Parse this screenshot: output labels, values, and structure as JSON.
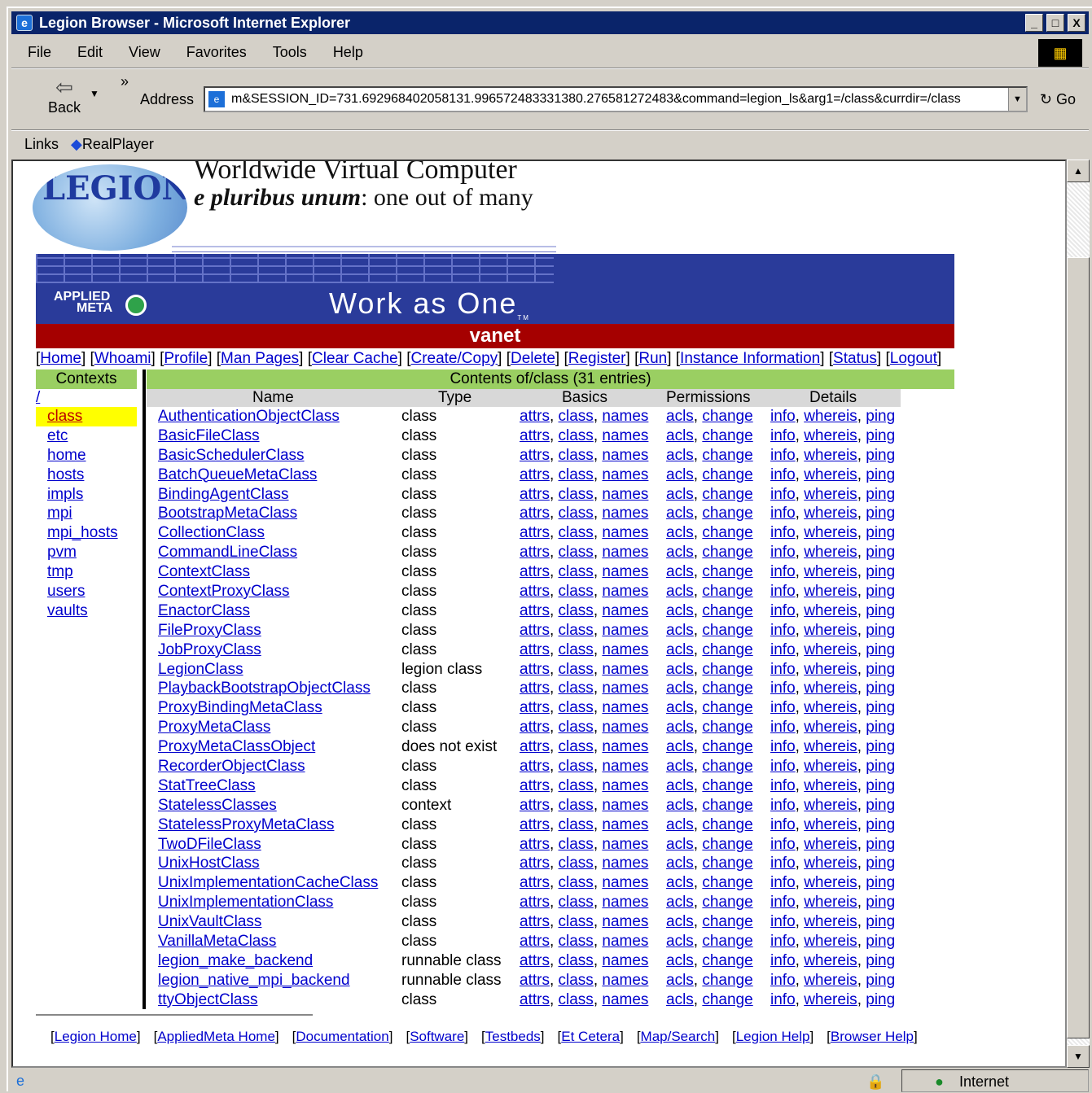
{
  "window": {
    "title": "Legion Browser - Microsoft Internet Explorer",
    "min": "_",
    "max": "□",
    "close": "X"
  },
  "menu": [
    "File",
    "Edit",
    "View",
    "Favorites",
    "Tools",
    "Help"
  ],
  "toolbar": {
    "back_label": "Back",
    "back_arrow": "⇦",
    "chevron": "»",
    "address_label": "Address",
    "address_value": "m&SESSION_ID=731.692968402058131.996572483331380.276581272483&command=legion_ls&arg1=/class&currdir=/class",
    "go_label": "Go"
  },
  "links_bar": {
    "links_label": "Links",
    "realplayer": "RealPlayer"
  },
  "page": {
    "logo": "LEGION",
    "tagline1": "Worldwide Virtual Computer",
    "tagline2_italic": "e pluribus unum",
    "tagline2_rest": ": one out of many",
    "applied_line1": "APPLIED",
    "applied_line2": "META",
    "work_as_one": "Work as One",
    "tm": "TM",
    "host": "vanet",
    "top_links": [
      "Home",
      "Whoami",
      "Profile",
      "Man Pages",
      "Clear Cache",
      "Create/Copy",
      "Delete",
      "Register",
      "Run",
      "Instance Information",
      "Status",
      "Logout"
    ],
    "contexts_header": "Contents",
    "contexts_title": "Contexts",
    "contents_header": "Contents of/class (31 entries)",
    "root": "/",
    "contexts": [
      "class",
      "etc",
      "home",
      "hosts",
      "impls",
      "mpi",
      "mpi_hosts",
      "pvm",
      "tmp",
      "users",
      "vaults"
    ],
    "selected_context": "class",
    "columns": {
      "name": "Name",
      "type": "Type",
      "basics": "Basics",
      "permissions": "Permissions",
      "details": "Details"
    },
    "links": {
      "attrs": "attrs",
      "class": "class",
      "names": "names",
      "acls": "acls",
      "change": "change",
      "info": "info",
      "whereis": "whereis",
      "ping": "ping"
    },
    "rows": [
      {
        "name": "AuthenticationObjectClass",
        "type": "class"
      },
      {
        "name": "BasicFileClass",
        "type": "class"
      },
      {
        "name": "BasicSchedulerClass",
        "type": "class"
      },
      {
        "name": "BatchQueueMetaClass",
        "type": "class"
      },
      {
        "name": "BindingAgentClass",
        "type": "class"
      },
      {
        "name": "BootstrapMetaClass",
        "type": "class"
      },
      {
        "name": "CollectionClass",
        "type": "class"
      },
      {
        "name": "CommandLineClass",
        "type": "class"
      },
      {
        "name": "ContextClass",
        "type": "class"
      },
      {
        "name": "ContextProxyClass",
        "type": "class"
      },
      {
        "name": "EnactorClass",
        "type": "class"
      },
      {
        "name": "FileProxyClass",
        "type": "class"
      },
      {
        "name": "JobProxyClass",
        "type": "class"
      },
      {
        "name": "LegionClass",
        "type": "legion class"
      },
      {
        "name": "PlaybackBootstrapObjectClass",
        "type": "class"
      },
      {
        "name": "ProxyBindingMetaClass",
        "type": "class"
      },
      {
        "name": "ProxyMetaClass",
        "type": "class"
      },
      {
        "name": "ProxyMetaClassObject",
        "type": "does not exist"
      },
      {
        "name": "RecorderObjectClass",
        "type": "class"
      },
      {
        "name": "StatTreeClass",
        "type": "class"
      },
      {
        "name": "StatelessClasses",
        "type": "context"
      },
      {
        "name": "StatelessProxyMetaClass",
        "type": "class"
      },
      {
        "name": "TwoDFileClass",
        "type": "class"
      },
      {
        "name": "UnixHostClass",
        "type": "class"
      },
      {
        "name": "UnixImplementationCacheClass",
        "type": "class"
      },
      {
        "name": "UnixImplementationClass",
        "type": "class"
      },
      {
        "name": "UnixVaultClass",
        "type": "class"
      },
      {
        "name": "VanillaMetaClass",
        "type": "class"
      },
      {
        "name": "legion_make_backend",
        "type": "runnable class"
      },
      {
        "name": "legion_native_mpi_backend",
        "type": "runnable class"
      },
      {
        "name": "ttyObjectClass",
        "type": "class"
      }
    ],
    "footer_links": [
      "Legion Home",
      "AppliedMeta Home",
      "Documentation",
      "Software",
      "Testbeds",
      "Et Cetera",
      "Map/Search",
      "Legion Help",
      "Browser Help"
    ]
  },
  "status": {
    "zone": "Internet"
  },
  "colors": {
    "title_bar": "#0a246a",
    "banner": "#2a3b9a",
    "host_bar": "#a50000",
    "header_green": "#9acf62",
    "selected": "#ffff00",
    "link": "#0000cc"
  }
}
